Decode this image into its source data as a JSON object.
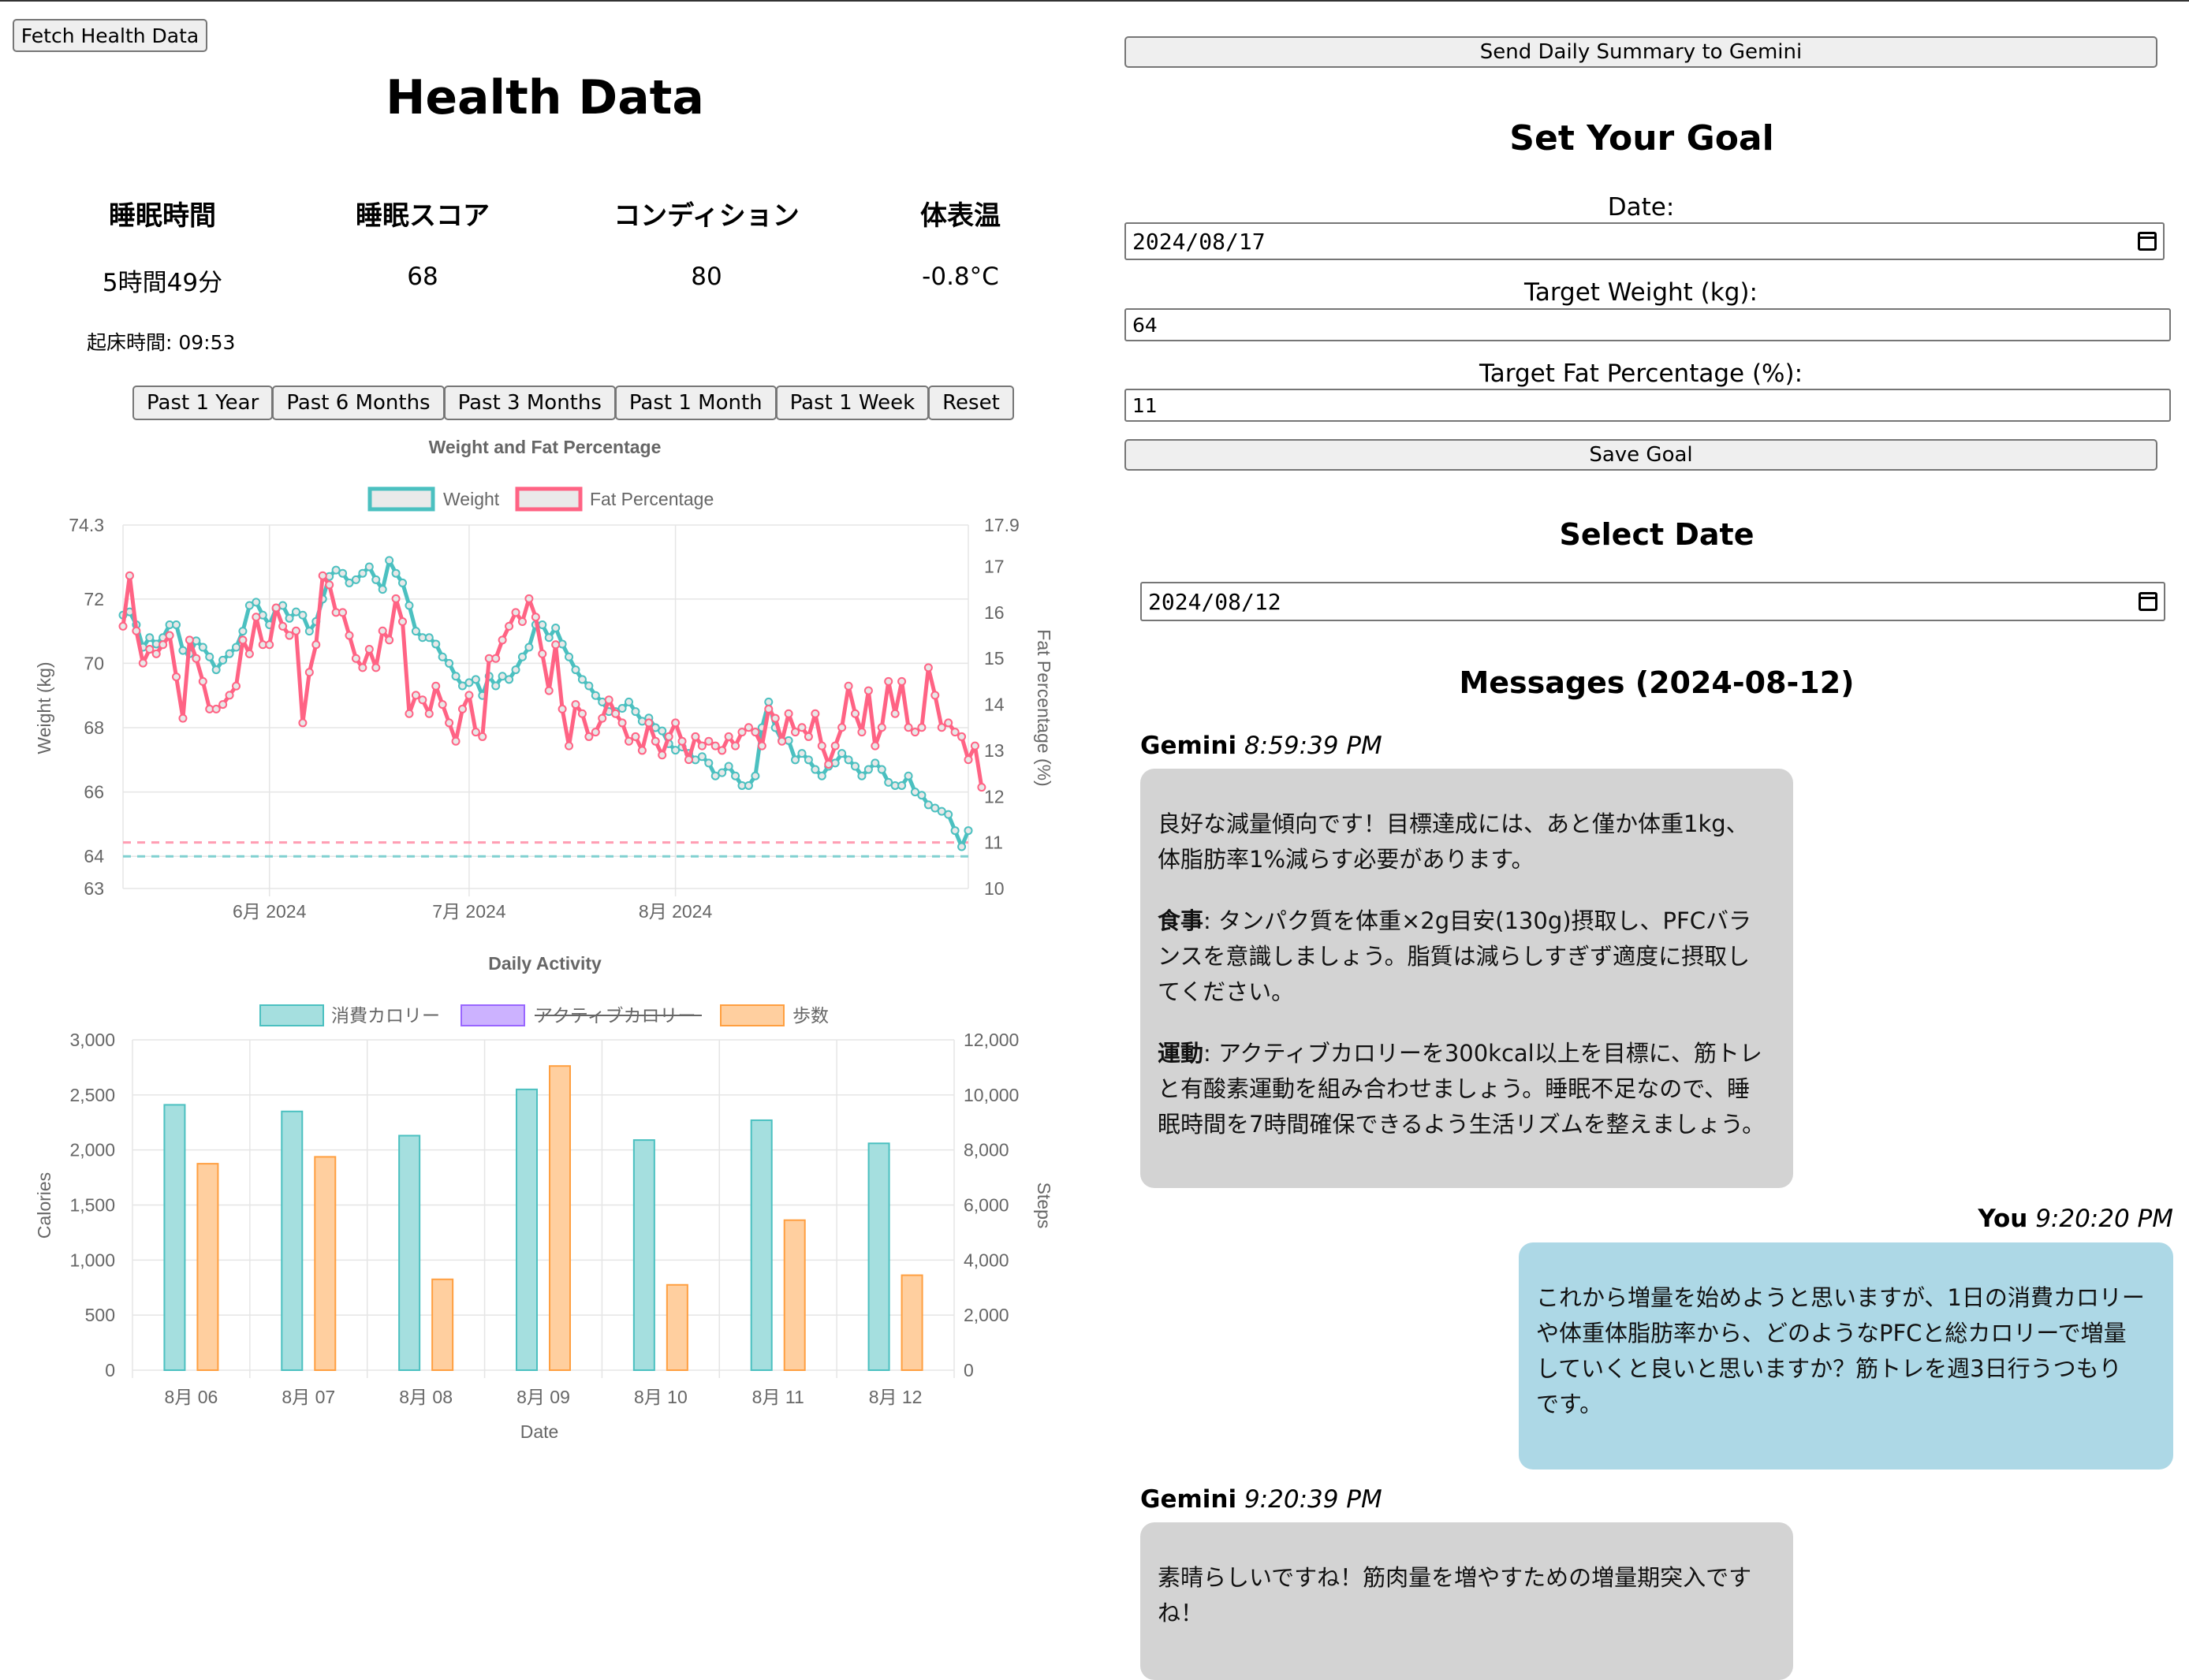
{
  "left": {
    "fetch_button": "Fetch Health Data",
    "title": "Health Data",
    "stats": [
      {
        "label": "睡眠時間",
        "value": "5時間49分"
      },
      {
        "label": "睡眠スコア",
        "value": "68"
      },
      {
        "label": "コンディション",
        "value": "80"
      },
      {
        "label": "体表温",
        "value": "-0.8°C"
      }
    ],
    "wake_time": "起床時間: 09:53",
    "range_buttons": [
      "Past 1 Year",
      "Past 6 Months",
      "Past 3 Months",
      "Past 1 Month",
      "Past 1 Week",
      "Reset"
    ]
  },
  "right": {
    "send_button": "Send Daily Summary to Gemini",
    "goal_title": "Set Your Goal",
    "date_label": "Date:",
    "date_value": "2024/08/17",
    "weight_label": "Target Weight (kg):",
    "weight_value": "64",
    "fat_label": "Target Fat Percentage (%):",
    "fat_value": "11",
    "save_button": "Save Goal",
    "select_title": "Select Date",
    "select_value": "2024/08/12",
    "messages_title": "Messages (2024-08-12)",
    "messages": [
      {
        "sender": "Gemini",
        "time": "8:59:39 PM",
        "paragraphs": [
          {
            "bold": "",
            "lines": [
              "良好な減量傾向です！目標達成には、あと僅か体重1kg、",
              "体脂肪率1%減らす必要があります。"
            ]
          },
          {
            "bold": "食事",
            "lines": [
              ": タンパク質を体重×2g目安(130g)摂取し、PFCバラ",
              "ンスを意識しましょう。脂質は減らしすぎず適度に摂取し",
              "てください。"
            ]
          },
          {
            "bold": "運動",
            "lines": [
              ": アクティブカロリーを300kcal以上を目標に、筋トレ",
              "と有酸素運動を組み合わせましょう。睡眠不足なので、睡",
              "眠時間を7時間確保できるよう生活リズムを整えましょう。"
            ]
          }
        ]
      },
      {
        "sender": "You",
        "time": "9:20:20 PM",
        "paragraphs": [
          {
            "bold": "",
            "lines": [
              "これから増量を始めようと思いますが、1日の消費カロリー",
              "や体重体脂肪率から、どのようなPFCと総カロリーで増量",
              "していくと良いと思いますか？筋トレを週3日行うつもり",
              "です。"
            ]
          }
        ]
      },
      {
        "sender": "Gemini",
        "time": "9:20:39 PM",
        "paragraphs": [
          {
            "bold": "",
            "lines": [
              "素晴らしいですね！筋肉量を増やすための増量期突入です",
              "ね！"
            ]
          }
        ]
      }
    ]
  },
  "colors": {
    "weight": "#4bc0c0",
    "fat": "#ff6384",
    "purple": "#9966ff",
    "orange": "#ff9f40"
  },
  "chart_data": [
    {
      "type": "line",
      "title": "Weight and Fat Percentage",
      "ylabel": "Weight (kg)",
      "y2label": "Fat Percentage (%)",
      "ylim": [
        63,
        74.3
      ],
      "y2lim": [
        10,
        17.9
      ],
      "y_ticks": [
        "74.3",
        "72",
        "70",
        "68",
        "66",
        "64",
        "63"
      ],
      "y2_ticks": [
        "17.9",
        "17",
        "16",
        "15",
        "14",
        "13",
        "12",
        "11",
        "10"
      ],
      "x_ticks": [
        "6月 2024",
        "7月 2024",
        "8月 2024"
      ],
      "x_start": "2024-05-01",
      "targets": {
        "weight": 64,
        "fat": 11
      },
      "series": [
        {
          "name": "Weight",
          "values": [
            71.5,
            71.6,
            71.2,
            70.5,
            70.8,
            70.6,
            70.8,
            71.2,
            71.2,
            70.4,
            70.3,
            70.7,
            70.5,
            70.2,
            69.8,
            70.1,
            70.3,
            70.5,
            71.0,
            71.8,
            71.9,
            71.5,
            71.2,
            71.7,
            71.8,
            71.4,
            71.6,
            71.5,
            71.0,
            71.3,
            72.0,
            72.7,
            72.9,
            72.8,
            72.5,
            72.6,
            72.8,
            73.0,
            72.6,
            72.3,
            73.2,
            72.8,
            72.5,
            71.8,
            71.0,
            70.8,
            70.8,
            70.6,
            70.2,
            70.0,
            69.6,
            69.3,
            69.4,
            69.5,
            69.0,
            69.6,
            69.3,
            69.6,
            69.5,
            69.8,
            70.2,
            70.5,
            71.2,
            71.2,
            70.8,
            71.1,
            70.6,
            70.2,
            69.8,
            69.5,
            69.3,
            69.0,
            68.8,
            68.5,
            68.5,
            68.6,
            68.8,
            68.5,
            68.2,
            68.3,
            68.0,
            67.9,
            67.5,
            67.3,
            67.4,
            67.2,
            67.0,
            67.1,
            66.9,
            66.5,
            66.6,
            66.8,
            66.5,
            66.2,
            66.2,
            66.5,
            68.0,
            68.8,
            68.0,
            67.6,
            67.6,
            67.0,
            67.2,
            67.0,
            66.7,
            66.5,
            66.8,
            66.9,
            67.2,
            67.0,
            66.8,
            66.5,
            66.7,
            66.9,
            66.7,
            66.3,
            66.2,
            66.2,
            66.5,
            66.0,
            65.9,
            65.6,
            65.5,
            65.4,
            65.3,
            64.8,
            64.3,
            64.8
          ],
          "color": "#4bc0c0"
        },
        {
          "name": "Fat Percentage",
          "values": [
            15.7,
            16.8,
            15.6,
            14.9,
            15.2,
            15.1,
            15.3,
            15.5,
            14.6,
            13.7,
            15.4,
            15.0,
            14.5,
            13.9,
            13.9,
            14.0,
            14.2,
            14.4,
            15.4,
            15.1,
            15.9,
            15.3,
            15.3,
            16.1,
            15.7,
            15.5,
            15.6,
            13.6,
            14.7,
            15.3,
            16.8,
            16.6,
            16.0,
            16.0,
            15.5,
            15.0,
            14.8,
            15.2,
            14.8,
            15.6,
            15.4,
            16.3,
            15.8,
            13.8,
            14.2,
            14.1,
            13.8,
            14.4,
            14.0,
            13.6,
            13.2,
            13.9,
            14.2,
            13.4,
            13.3,
            15.0,
            15.0,
            15.4,
            15.7,
            16.0,
            15.8,
            16.3,
            15.9,
            15.1,
            14.3,
            15.3,
            13.9,
            13.1,
            14.0,
            13.8,
            13.3,
            13.4,
            13.7,
            14.1,
            13.8,
            13.6,
            13.2,
            13.3,
            13.0,
            13.6,
            13.2,
            12.9,
            13.3,
            13.6,
            13.2,
            12.8,
            13.3,
            13.1,
            13.2,
            13.1,
            13.0,
            13.3,
            13.1,
            13.4,
            13.5,
            13.4,
            13.1,
            13.9,
            13.7,
            13.2,
            13.8,
            13.4,
            13.5,
            13.3,
            13.8,
            13.1,
            12.7,
            13.1,
            13.5,
            14.4,
            13.8,
            13.4,
            14.3,
            13.1,
            13.5,
            14.5,
            13.8,
            14.5,
            13.5,
            13.4,
            13.5,
            14.8,
            14.2,
            13.5,
            13.6,
            13.4,
            13.3,
            12.8,
            13.1,
            12.2
          ],
          "color": "#ff6384"
        }
      ],
      "legend": "top"
    },
    {
      "type": "bar",
      "title": "Daily Activity",
      "xlabel": "Date",
      "ylabel": "Calories",
      "y2label": "Steps",
      "categories": [
        "8月 06",
        "8月 07",
        "8月 08",
        "8月 09",
        "8月 10",
        "8月 11",
        "8月 12"
      ],
      "ylim": [
        0,
        3000
      ],
      "y2lim": [
        0,
        12000
      ],
      "y_ticks": [
        "3,000",
        "2,500",
        "2,000",
        "1,500",
        "1,000",
        "500",
        "0"
      ],
      "y2_ticks": [
        "12,000",
        "10,000",
        "8,000",
        "6,000",
        "4,000",
        "2,000",
        "0"
      ],
      "series": [
        {
          "name": "消費カロリー",
          "values": [
            2410,
            2350,
            2130,
            2550,
            2090,
            2270,
            2060
          ],
          "color": "#4bc0c0",
          "axis": "y"
        },
        {
          "name": "アクティブカロリー",
          "values": [],
          "color": "#9966ff",
          "hidden": true
        },
        {
          "name": "歩数",
          "values": [
            7500,
            7750,
            3300,
            11050,
            3100,
            5450,
            3450
          ],
          "color": "#ff9f40",
          "axis": "y2"
        }
      ],
      "legend": "top"
    }
  ]
}
